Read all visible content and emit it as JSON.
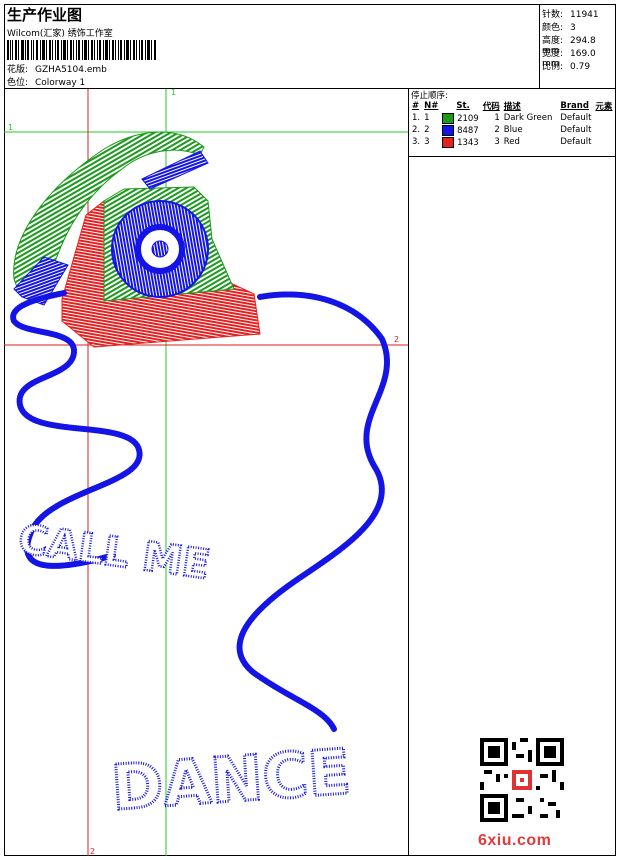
{
  "header": {
    "title": "生产作业图",
    "company": "Wilcom(汇家) 绣饰工作室",
    "file_label": "花版:",
    "file_value": "GZHA5104.emb",
    "colorway_label": "色位:",
    "colorway_value": "Colorway 1"
  },
  "stats": [
    {
      "label": "针数:",
      "value": "11941"
    },
    {
      "label": "颜色:",
      "value": "3"
    },
    {
      "label": "高度:",
      "value": "294.8 mm"
    },
    {
      "label": "宽度:",
      "value": "169.0 mm"
    },
    {
      "label": "比例:",
      "value": "0.79"
    }
  ],
  "stop_sequence": {
    "title": "停止顺序:",
    "columns": [
      "#",
      "N#",
      "St.",
      "代码",
      "描述",
      "Brand",
      "元素"
    ],
    "rows": [
      {
        "num": "1.",
        "n": "1",
        "st": "2109",
        "code": "1",
        "desc": "Dark Green",
        "brand": "Default",
        "color": "#1a9a1a"
      },
      {
        "num": "2.",
        "n": "2",
        "st": "8487",
        "code": "2",
        "desc": "Blue",
        "brand": "Default",
        "color": "#1414e6"
      },
      {
        "num": "3.",
        "n": "3",
        "st": "1343",
        "code": "3",
        "desc": "Red",
        "brand": "Default",
        "color": "#e62020"
      }
    ]
  },
  "guides": {
    "green_label": "1",
    "red_label": "2"
  },
  "design": {
    "text_top": "CALL ME",
    "text_bottom": "DANCE"
  },
  "watermark": "6xiu.com",
  "colors": {
    "green": "#1a9a1a",
    "blue": "#1414e6",
    "red": "#e62020",
    "guide_green": "#22cc22",
    "guide_red": "#dd2222"
  }
}
